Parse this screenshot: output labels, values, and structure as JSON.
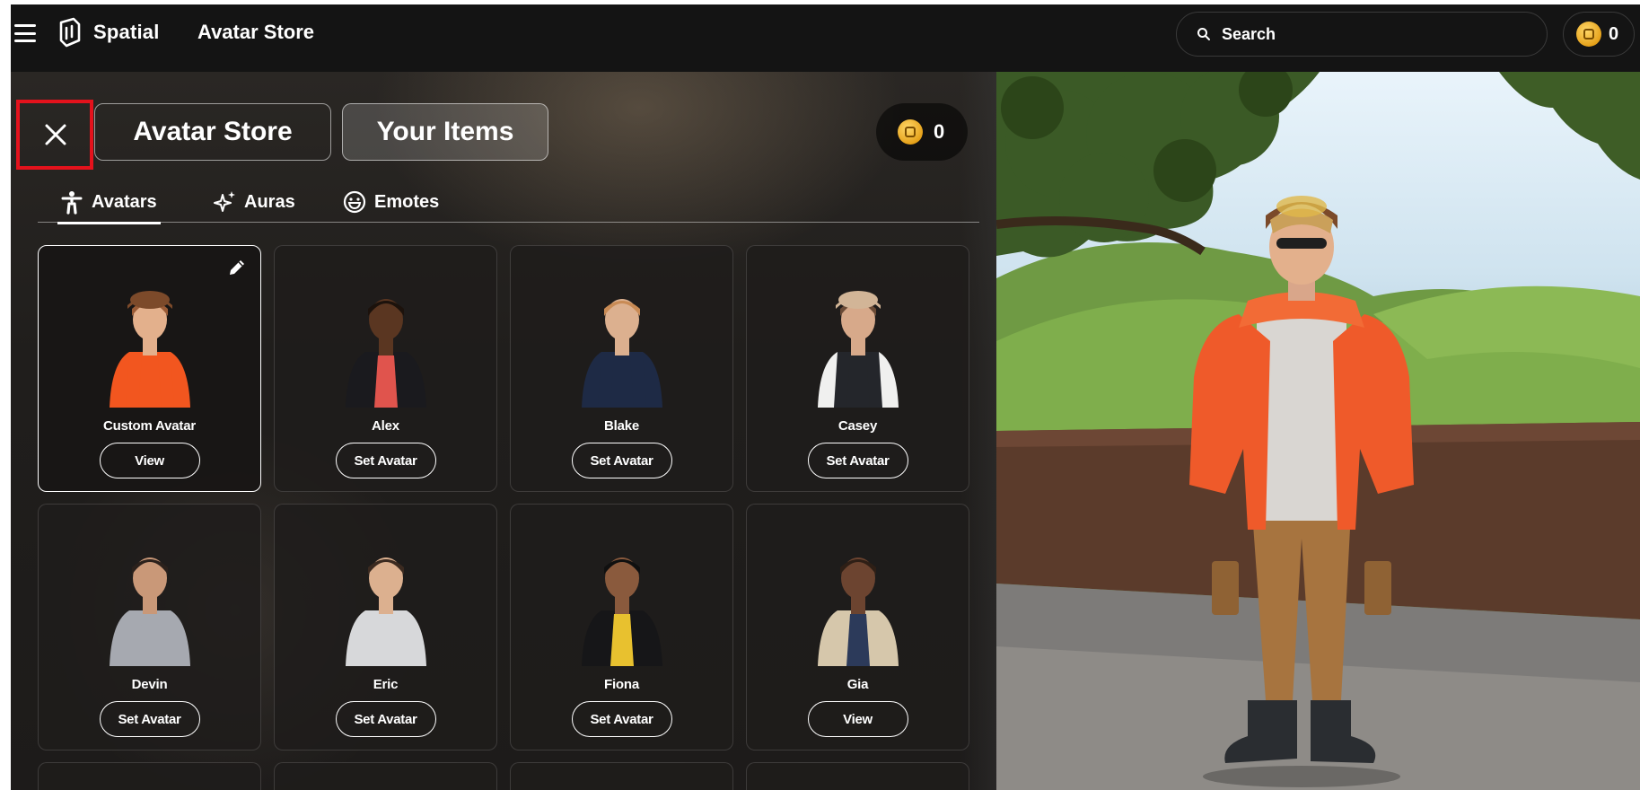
{
  "topbar": {
    "brand": "Spatial",
    "title": "Avatar Store",
    "search_label": "Search",
    "coins": "0"
  },
  "panel": {
    "store_label": "Avatar Store",
    "items_label": "Your Items",
    "coins": "0",
    "tabs": [
      {
        "label": "Avatars",
        "icon": "person-icon",
        "active": true
      },
      {
        "label": "Auras",
        "icon": "sparkles-icon",
        "active": false
      },
      {
        "label": "Emotes",
        "icon": "smile-icon",
        "active": false
      }
    ]
  },
  "avatars": [
    {
      "name": "Custom Avatar",
      "action": "View",
      "selected": true,
      "shirt": "#f2561f",
      "skin": "#e3b08c",
      "hair": "#9a5b36",
      "hat": "#7c4a2a"
    },
    {
      "name": "Alex",
      "action": "Set Avatar",
      "selected": false,
      "shirt": "#1a1a1e",
      "skin": "#5a3621",
      "hair": "#1c120c",
      "inner": "#e0544d"
    },
    {
      "name": "Blake",
      "action": "Set Avatar",
      "selected": false,
      "shirt": "#1e2a45",
      "skin": "#dcb08f",
      "hair": "#c98b55"
    },
    {
      "name": "Casey",
      "action": "Set Avatar",
      "selected": false,
      "shirt": "#24262b",
      "skin": "#d7a98a",
      "hair": "#6b4b36",
      "hat": "#d2b597",
      "sleeves": "#f0f0ef"
    },
    {
      "name": "Devin",
      "action": "Set Avatar",
      "selected": false,
      "shirt": "#a6a9b0",
      "skin": "#c99878",
      "hair": "#2b211c"
    },
    {
      "name": "Eric",
      "action": "Set Avatar",
      "selected": false,
      "shirt": "#d7d8da",
      "skin": "#dcb08f",
      "hair": "#3b2a20"
    },
    {
      "name": "Fiona",
      "action": "Set Avatar",
      "selected": false,
      "shirt": "#161618",
      "skin": "#8a5a3d",
      "hair": "#101010",
      "inner": "#e8c12f"
    },
    {
      "name": "Gia",
      "action": "View",
      "selected": false,
      "shirt": "#d6c7ab",
      "skin": "#6c4430",
      "hair": "#2e1f16",
      "inner": "#2c3a5a"
    }
  ]
}
